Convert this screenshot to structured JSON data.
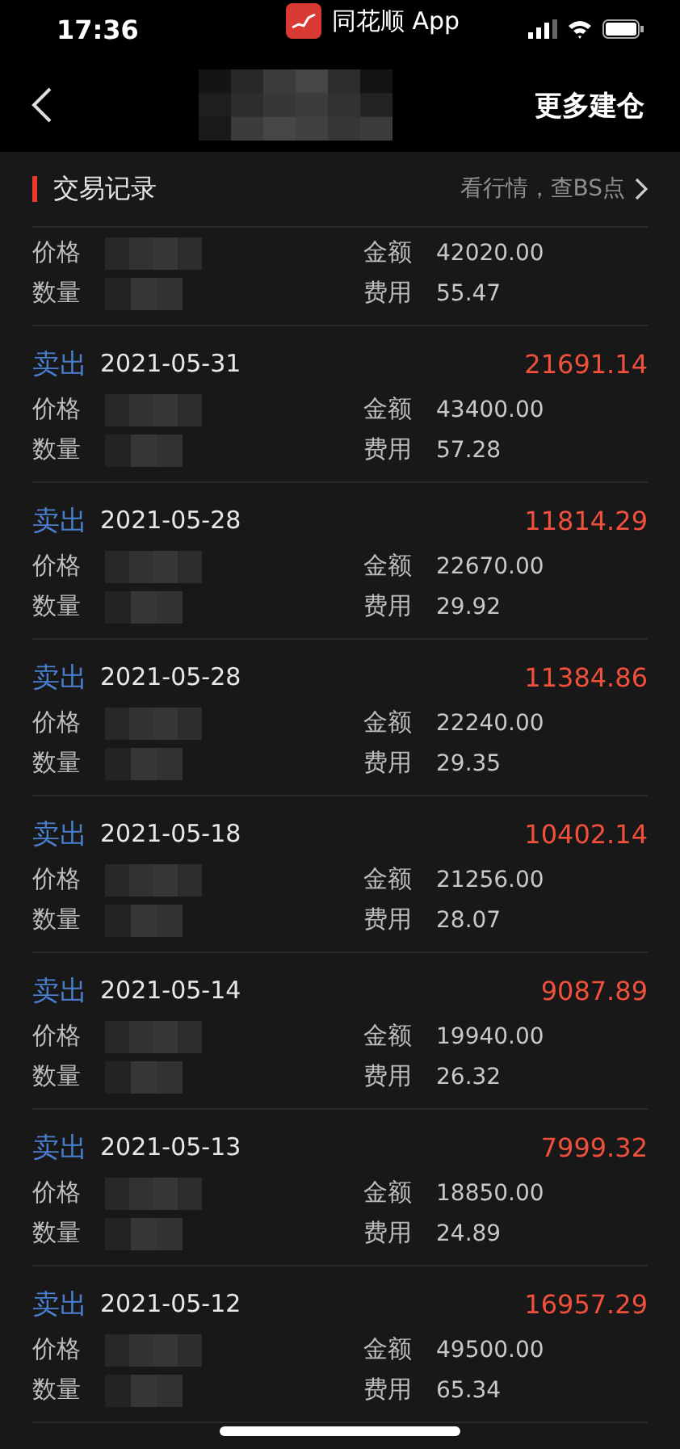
{
  "status_bar": {
    "time": "17:36",
    "app_name": "同花顺 App"
  },
  "nav": {
    "action": "更多建仓"
  },
  "section": {
    "title": "交易记录",
    "link": "看行情，查BS点"
  },
  "records": [
    {
      "price_label": "价格",
      "quantity_label": "数量",
      "amount_label": "金额",
      "amount": "42020.00",
      "fee_label": "费用",
      "fee": "55.47"
    },
    {
      "side": "卖出",
      "date": "2021-05-31",
      "total": "21691.14",
      "price_label": "价格",
      "quantity_label": "数量",
      "amount_label": "金额",
      "amount": "43400.00",
      "fee_label": "费用",
      "fee": "57.28"
    },
    {
      "side": "卖出",
      "date": "2021-05-28",
      "total": "11814.29",
      "price_label": "价格",
      "quantity_label": "数量",
      "amount_label": "金额",
      "amount": "22670.00",
      "fee_label": "费用",
      "fee": "29.92"
    },
    {
      "side": "卖出",
      "date": "2021-05-28",
      "total": "11384.86",
      "price_label": "价格",
      "quantity_label": "数量",
      "amount_label": "金额",
      "amount": "22240.00",
      "fee_label": "费用",
      "fee": "29.35"
    },
    {
      "side": "卖出",
      "date": "2021-05-18",
      "total": "10402.14",
      "price_label": "价格",
      "quantity_label": "数量",
      "amount_label": "金额",
      "amount": "21256.00",
      "fee_label": "费用",
      "fee": "28.07"
    },
    {
      "side": "卖出",
      "date": "2021-05-14",
      "total": "9087.89",
      "price_label": "价格",
      "quantity_label": "数量",
      "amount_label": "金额",
      "amount": "19940.00",
      "fee_label": "费用",
      "fee": "26.32"
    },
    {
      "side": "卖出",
      "date": "2021-05-13",
      "total": "7999.32",
      "price_label": "价格",
      "quantity_label": "数量",
      "amount_label": "金额",
      "amount": "18850.00",
      "fee_label": "费用",
      "fee": "24.89"
    },
    {
      "side": "卖出",
      "date": "2021-05-12",
      "total": "16957.29",
      "price_label": "价格",
      "quantity_label": "数量",
      "amount_label": "金额",
      "amount": "49500.00",
      "fee_label": "费用",
      "fee": "65.34"
    }
  ]
}
